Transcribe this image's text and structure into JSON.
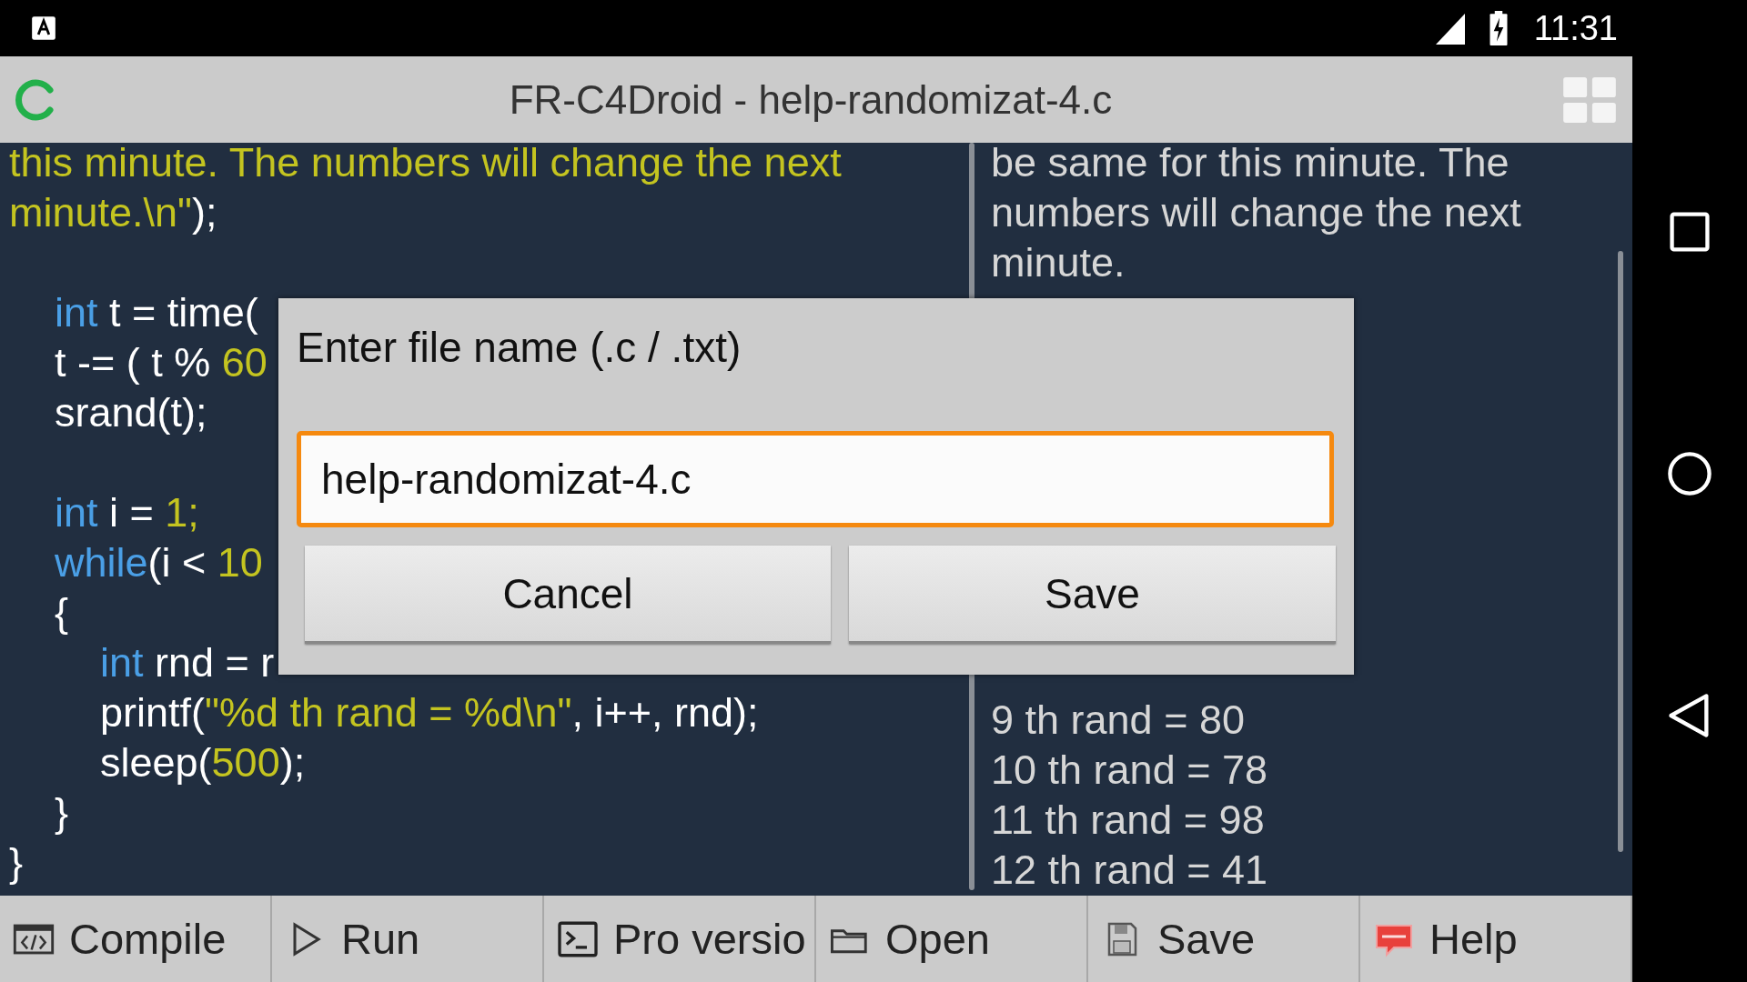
{
  "status_bar": {
    "time": "11:31"
  },
  "app_bar": {
    "title": "FR-C4Droid - help-randomizat-4.c"
  },
  "editor": {
    "lines": [
      {
        "kind": "code",
        "tokens": [
          {
            "text": "this minute. The numbers will change the next",
            "kind": "literal"
          }
        ]
      },
      {
        "kind": "code",
        "tokens": [
          {
            "text": "minute.\\n\"",
            "kind": "literal"
          },
          {
            "text": ");",
            "kind": "plain"
          }
        ]
      },
      {
        "kind": "blank"
      },
      {
        "kind": "code",
        "tokens": [
          {
            "text": "    int",
            "kind": "keyword"
          },
          {
            "text": " t = time(",
            "kind": "plain"
          }
        ]
      },
      {
        "kind": "code",
        "tokens": [
          {
            "text": "    t -= ( t % ",
            "kind": "plain"
          },
          {
            "text": "60",
            "kind": "literal"
          }
        ]
      },
      {
        "kind": "code",
        "tokens": [
          {
            "text": "    srand(t);",
            "kind": "plain"
          }
        ]
      },
      {
        "kind": "blank"
      },
      {
        "kind": "code",
        "tokens": [
          {
            "text": "    int",
            "kind": "keyword"
          },
          {
            "text": " i = ",
            "kind": "plain"
          },
          {
            "text": "1;",
            "kind": "literal"
          }
        ]
      },
      {
        "kind": "code",
        "tokens": [
          {
            "text": "    while",
            "kind": "keyword"
          },
          {
            "text": "(i < ",
            "kind": "plain"
          },
          {
            "text": "10",
            "kind": "literal"
          }
        ]
      },
      {
        "kind": "code",
        "tokens": [
          {
            "text": "    {",
            "kind": "plain"
          }
        ]
      },
      {
        "kind": "code",
        "tokens": [
          {
            "text": "        int",
            "kind": "keyword"
          },
          {
            "text": " rnd = r",
            "kind": "plain"
          }
        ]
      },
      {
        "kind": "code",
        "tokens": [
          {
            "text": "        printf(",
            "kind": "plain"
          },
          {
            "text": "\"%d th rand = %d\\n\"",
            "kind": "literal"
          },
          {
            "text": ", i++, rnd);",
            "kind": "plain"
          }
        ]
      },
      {
        "kind": "code",
        "tokens": [
          {
            "text": "        sleep(",
            "kind": "plain"
          },
          {
            "text": "500",
            "kind": "literal"
          },
          {
            "text": ");",
            "kind": "plain"
          }
        ]
      },
      {
        "kind": "code",
        "tokens": [
          {
            "text": "    }",
            "kind": "plain"
          }
        ]
      },
      {
        "kind": "code",
        "tokens": [
          {
            "text": "}",
            "kind": "plain"
          }
        ]
      }
    ]
  },
  "output": {
    "lines_top": [
      "be same for this minute. The",
      "numbers will change the next",
      "minute."
    ],
    "lines_bottom": [
      "9 th rand = 80",
      "10 th rand = 78",
      "11 th rand = 98",
      "12 th rand = 41"
    ]
  },
  "dialog": {
    "title": "Enter file name (.c / .txt)",
    "file_name": {
      "value": "help-randomizat-4.c",
      "focused": true
    },
    "buttons": [
      "Cancel",
      "Save"
    ]
  },
  "toolbar": [
    {
      "label": "Compile",
      "kind": "compile"
    },
    {
      "label": "Run",
      "kind": "run"
    },
    {
      "label": "Pro versio",
      "kind": "terminal"
    },
    {
      "label": "Open",
      "kind": "open"
    },
    {
      "label": "Save",
      "kind": "save"
    },
    {
      "label": "Help",
      "kind": "help"
    }
  ]
}
